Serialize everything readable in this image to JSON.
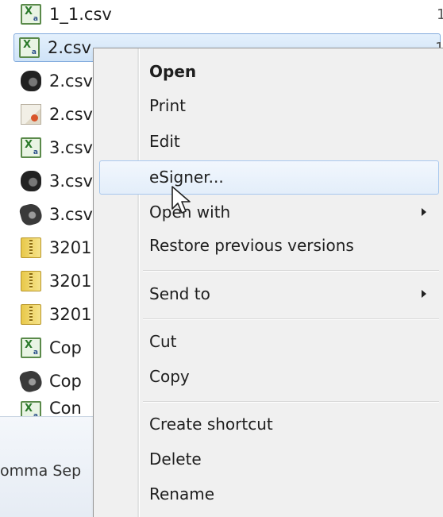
{
  "files": [
    {
      "name": "1_1.csv",
      "icon": "csv-file-icon",
      "extra": "1"
    },
    {
      "name": "2.csv",
      "icon": "csv-file-icon",
      "extra": "1",
      "selected": true
    },
    {
      "name": "2.csv",
      "icon": "media-file-icon"
    },
    {
      "name": "2.csv",
      "icon": "certificate-file-icon"
    },
    {
      "name": "3.csv",
      "icon": "csv-file-icon"
    },
    {
      "name": "3.csv",
      "icon": "media-file-icon"
    },
    {
      "name": "3.csv",
      "icon": "media-file-icon-alt"
    },
    {
      "name": "3201",
      "icon": "zip-folder-icon"
    },
    {
      "name": "3201",
      "icon": "zip-folder-icon"
    },
    {
      "name": "3201",
      "icon": "zip-folder-icon"
    },
    {
      "name": "Cop",
      "icon": "csv-file-icon"
    },
    {
      "name": "Cop",
      "icon": "media-file-icon-alt"
    },
    {
      "name": "Con",
      "icon": "csv-file-icon"
    }
  ],
  "details_pane": {
    "type_text": "omma Sep"
  },
  "context_menu": {
    "items": {
      "open": "Open",
      "print": "Print",
      "edit": "Edit",
      "esigner": "eSigner...",
      "open_with": "Open with",
      "restore": "Restore previous versions",
      "send_to": "Send to",
      "cut": "Cut",
      "copy": "Copy",
      "create_shortcut": "Create shortcut",
      "delete": "Delete",
      "rename": "Rename"
    },
    "hovered_item": "eSigner..."
  },
  "colors": {
    "selection_border": "#84acdd",
    "hover_border": "#a8c8ee",
    "menu_background": "#f0f0f0"
  }
}
